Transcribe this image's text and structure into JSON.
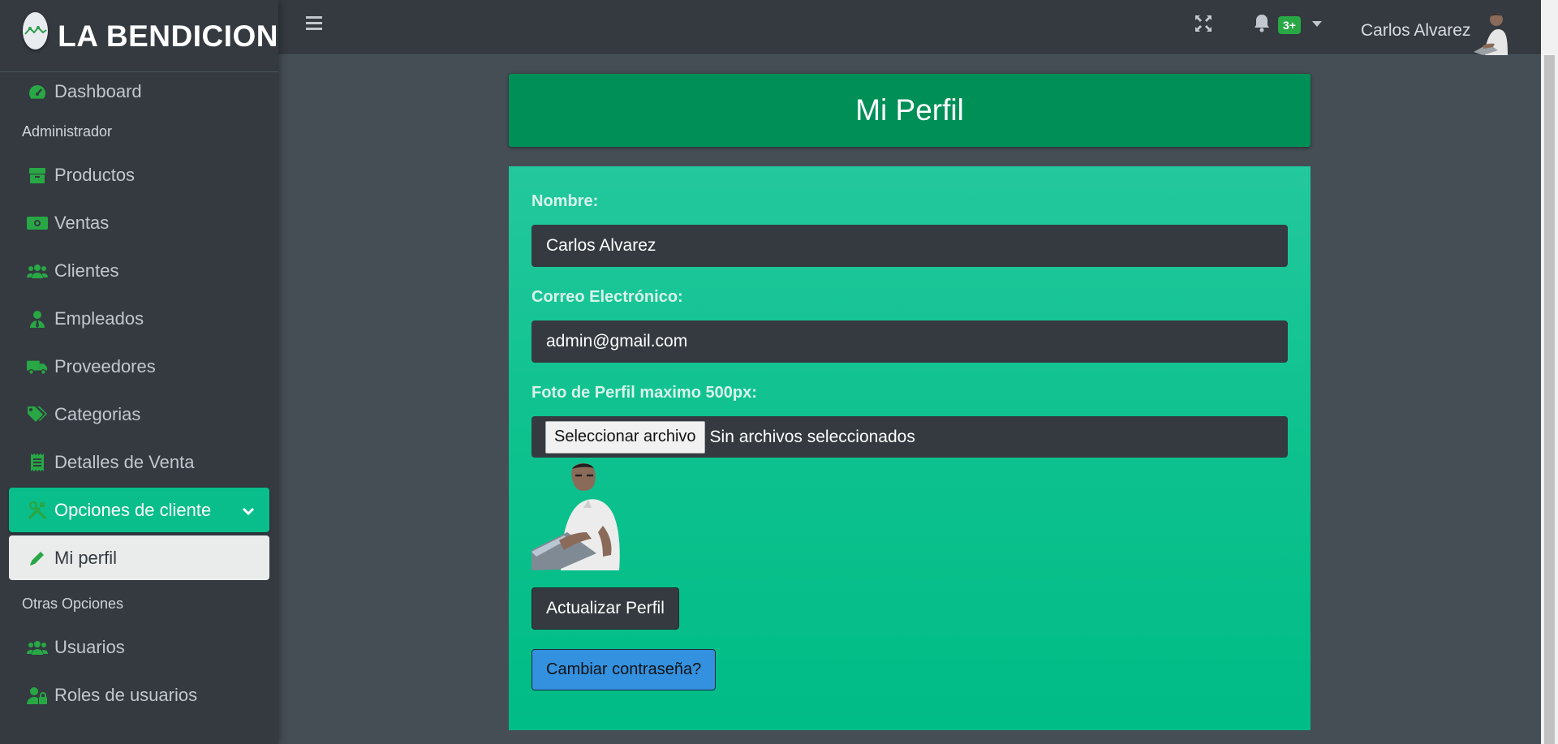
{
  "brand": {
    "name": "LA BENDICION"
  },
  "sidebar": {
    "items": [
      {
        "label": "Dashboard",
        "icon": "tachometer-icon"
      },
      {
        "section": "Administrador"
      },
      {
        "label": "Productos",
        "icon": "box-icon"
      },
      {
        "label": "Ventas",
        "icon": "money-bill-icon"
      },
      {
        "label": "Clientes",
        "icon": "users-icon"
      },
      {
        "label": "Empleados",
        "icon": "user-tie-icon"
      },
      {
        "label": "Proveedores",
        "icon": "truck-icon"
      },
      {
        "label": "Categorias",
        "icon": "tags-icon"
      },
      {
        "label": "Detalles de Venta",
        "icon": "receipt-icon"
      },
      {
        "label": "Opciones de cliente",
        "icon": "tools-icon",
        "state": "expanded"
      },
      {
        "label": "Mi perfil",
        "icon": "pencil-icon",
        "state": "active"
      },
      {
        "section": "Otras Opciones"
      },
      {
        "label": "Usuarios",
        "icon": "users-icon"
      },
      {
        "label": "Roles de usuarios",
        "icon": "user-lock-icon"
      }
    ]
  },
  "navbar": {
    "notification_count": "3+",
    "user_name": "Carlos Alvarez"
  },
  "page": {
    "title": "Mi Perfil",
    "form": {
      "name_label": "Nombre:",
      "name_value": "Carlos Alvarez",
      "email_label": "Correo Electrónico:",
      "email_value": "admin@gmail.com",
      "photo_label": "Foto de Perfil maximo 500px:",
      "file_button": "Seleccionar archivo",
      "file_status": "Sin archivos seleccionados",
      "update_button": "Actualizar Perfil",
      "password_button": "Cambiar contraseña?"
    }
  },
  "colors": {
    "accent": "#09be8a",
    "title_bar": "#008f57",
    "icon_green": "#28a745",
    "link_button": "#3391e0"
  }
}
